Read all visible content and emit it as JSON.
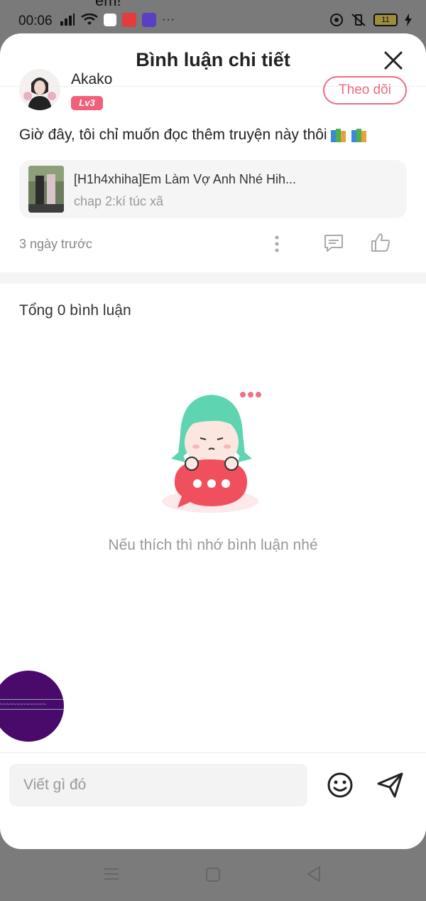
{
  "status_bar": {
    "time": "00:06",
    "peek_text": "em!",
    "dots": "···",
    "battery": "11"
  },
  "sheet": {
    "title": "Bình luận chi tiết"
  },
  "comment": {
    "username": "Akako",
    "level": "Lv3",
    "follow_label": "Theo dõi",
    "text": "Giờ đây, tôi chỉ muốn đọc thêm truyện này thôi",
    "time": "3 ngày trước",
    "manga": {
      "title": "[H1h4xhiha]Em Làm Vợ Anh Nhé Hih...",
      "chapter": "chap 2:kí túc xã"
    }
  },
  "comments_section": {
    "total": "Tổng 0 bình luận",
    "empty_message": "Nếu thích thì nhớ bình luận nhé"
  },
  "composer": {
    "placeholder": "Viết gì đó"
  },
  "colors": {
    "accent": "#f06b82",
    "badge": "#f0607a"
  }
}
